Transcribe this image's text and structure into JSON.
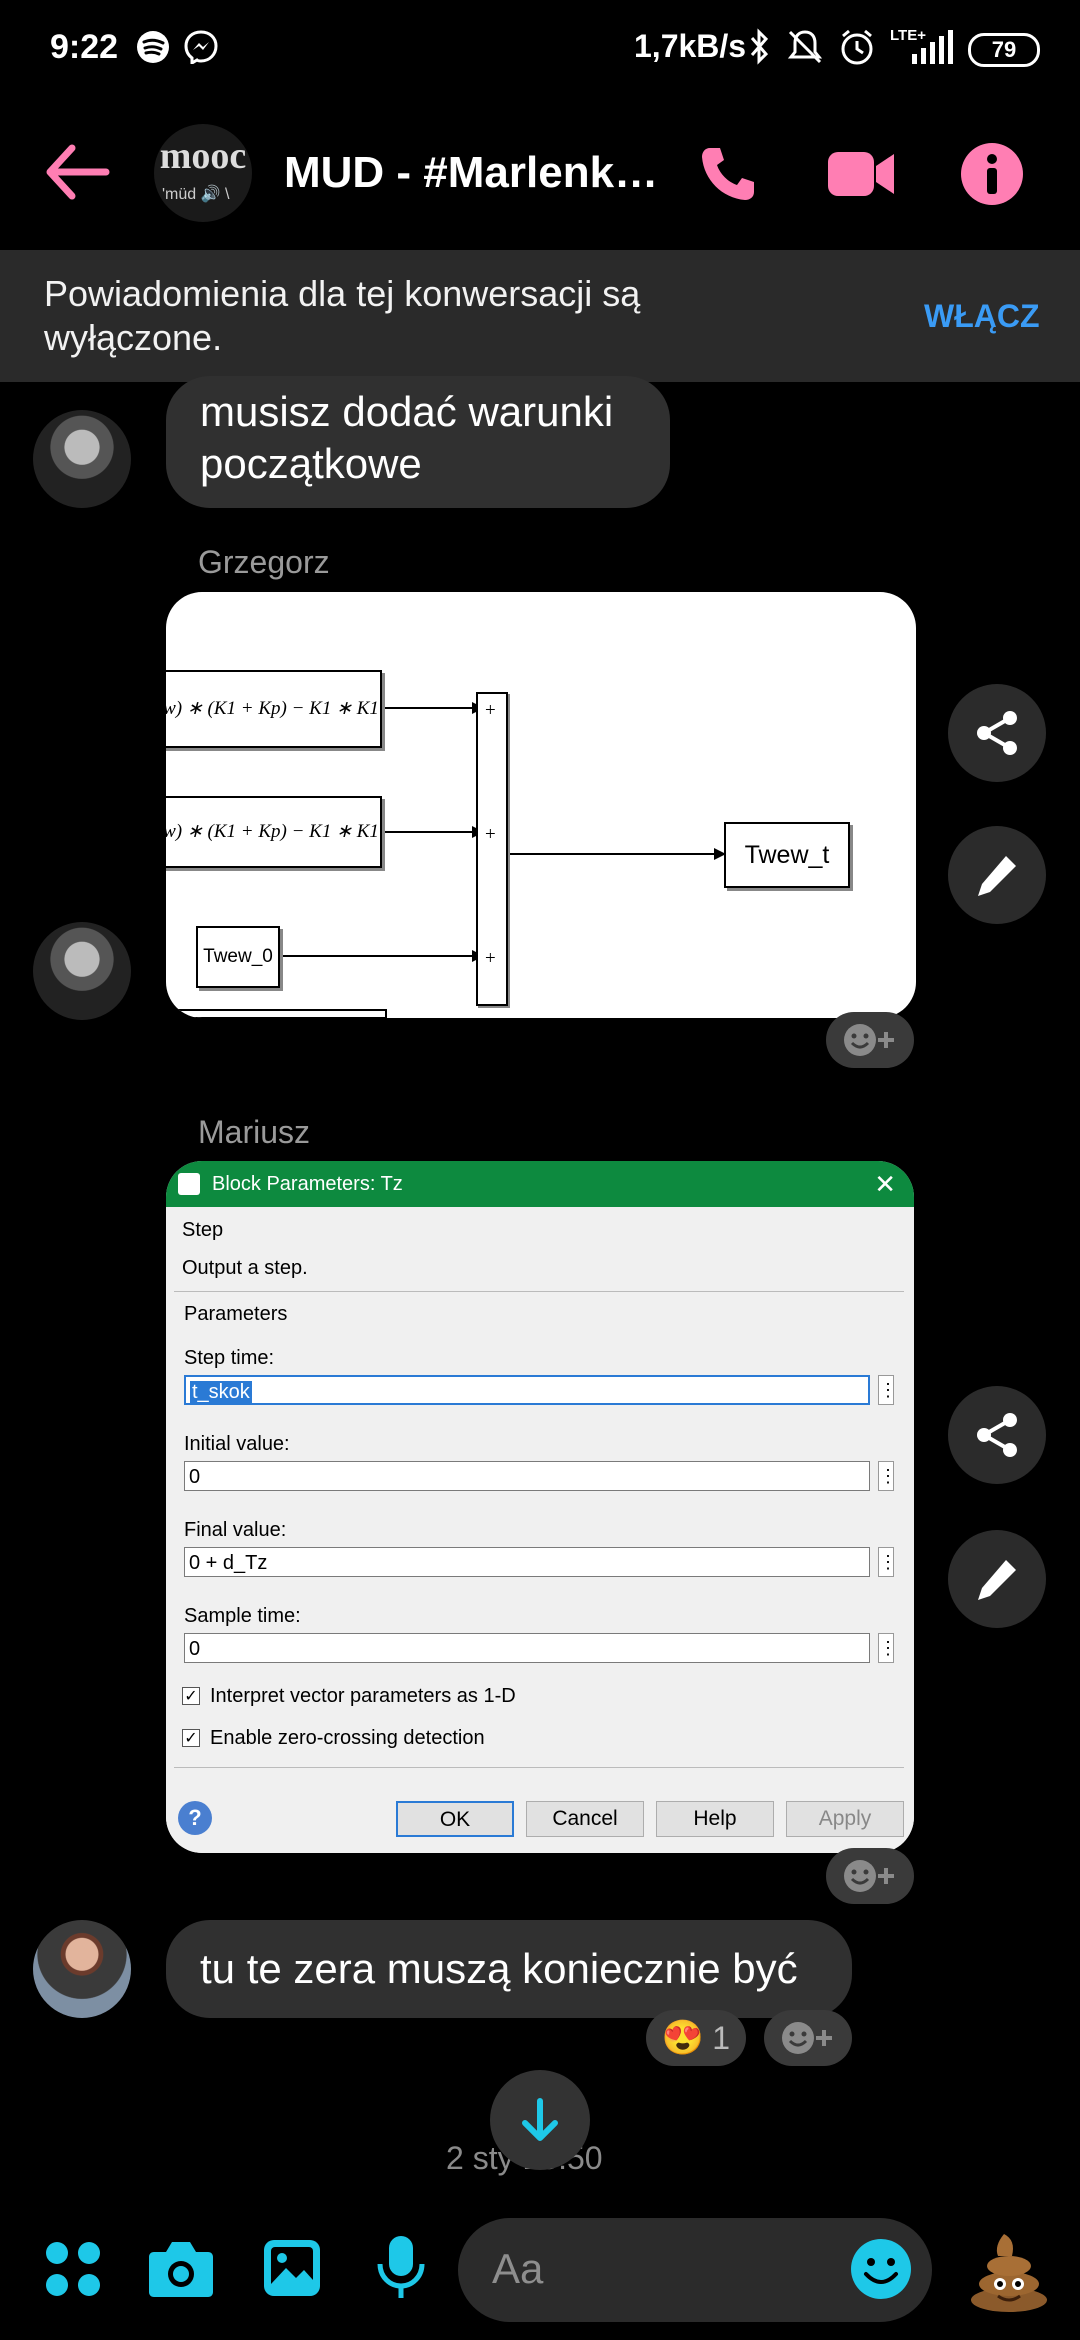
{
  "status_bar": {
    "time": "9:22",
    "network_speed": "1,7kB/s",
    "network_type": "LTE+",
    "battery": "79",
    "icons": [
      "spotify-icon",
      "messenger-icon",
      "bluetooth-icon",
      "mute-icon",
      "alarm-icon",
      "signal-icon"
    ]
  },
  "header": {
    "title": "MUD - #Marlenka...",
    "group_avatar_text": "mooc",
    "group_avatar_subtext": "'müd 🔊 \\"
  },
  "banner": {
    "text": "Powiadomienia dla tej konwersacji są wyłączone.",
    "action": "WŁĄCZ"
  },
  "messages": [
    {
      "type": "text",
      "text": "musisz dodać warunki początkowe"
    },
    {
      "type": "image",
      "sender": "Grzegorz",
      "diagram": {
        "block1": "w) ∗ (K1 + Kp) − K1 ∗ K1",
        "block2": "w) ∗ (K1 + Kp) − K1 ∗ K1",
        "block3": "Twew_0",
        "output": "Twew_t",
        "sum_signs": [
          "+",
          "+",
          "+"
        ]
      }
    },
    {
      "type": "image",
      "sender": "Mariusz",
      "dialog": {
        "title": "Block Parameters: Tz",
        "block_type": "Step",
        "description": "Output a step.",
        "section": "Parameters",
        "fields": [
          {
            "label": "Step time:",
            "value": "t_skok"
          },
          {
            "label": "Initial value:",
            "value": "0"
          },
          {
            "label": "Final value:",
            "value": "0 + d_Tz"
          },
          {
            "label": "Sample time:",
            "value": "0"
          }
        ],
        "checkboxes": [
          {
            "label": "Interpret vector parameters as 1-D",
            "checked": true
          },
          {
            "label": "Enable zero-crossing detection",
            "checked": true
          }
        ],
        "buttons": [
          "OK",
          "Cancel",
          "Help",
          "Apply"
        ]
      }
    },
    {
      "type": "text",
      "text": "tu te zera muszą koniecznie być",
      "reaction": {
        "emoji": "😍",
        "count": "1"
      }
    }
  ],
  "timestamp": "2 sty 18:50",
  "composer": {
    "placeholder": "Aa"
  },
  "colors": {
    "accent_pink": "#ff7eb3",
    "accent_cyan": "#1ec8e8",
    "link_blue": "#3a9bf5"
  }
}
